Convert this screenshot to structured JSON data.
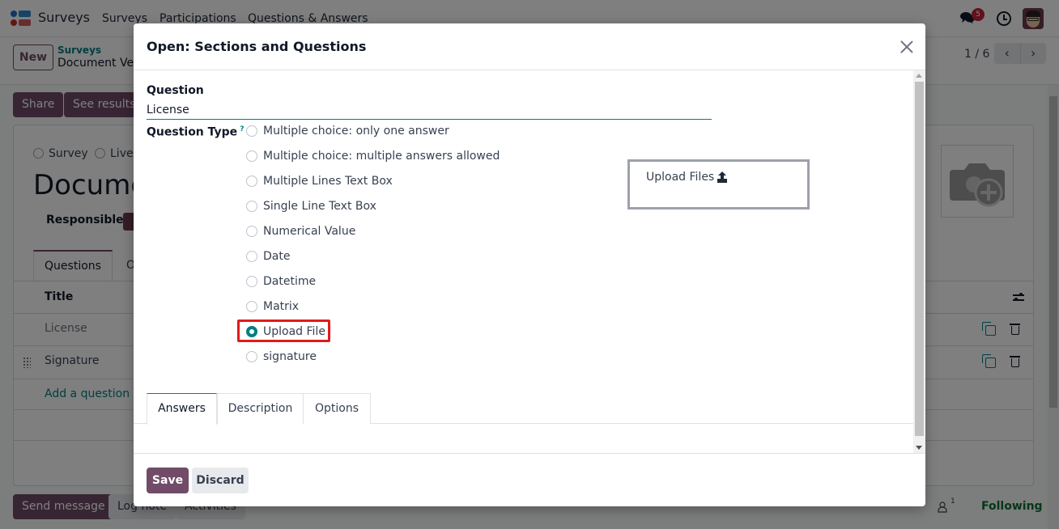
{
  "navbar": {
    "app_name": "Surveys",
    "menu": [
      "Surveys",
      "Participations",
      "Questions & Answers"
    ],
    "messages_badge": "5",
    "icons": [
      "chat-icon",
      "clock-icon",
      "user-avatar"
    ]
  },
  "control_panel": {
    "new_label": "New",
    "breadcrumb_parent": "Surveys",
    "breadcrumb_current": "Document Verification",
    "pager": "1 / 6",
    "prev_icon": "‹",
    "next_icon": "›"
  },
  "actions": {
    "share": "Share",
    "see_results": "See results"
  },
  "form": {
    "survey_type_options": [
      "Survey",
      "Live"
    ],
    "title": "Document Verification",
    "responsible_label": "Responsible",
    "tabs": [
      "Questions",
      "Options"
    ],
    "list": {
      "header_title": "Title",
      "rows": [
        {
          "title": "License"
        },
        {
          "title": "Signature"
        }
      ],
      "add_label": "Add a question"
    }
  },
  "chatter": {
    "send_message": "Send message",
    "log_note": "Log note",
    "activities": "Activities",
    "followers_count": "1",
    "following": "Following"
  },
  "modal": {
    "title": "Open: Sections and Questions",
    "question_label": "Question",
    "question_value": "License",
    "question_type_label": "Question Type",
    "help_mark": "?",
    "question_types": [
      {
        "label": "Multiple choice: only one answer",
        "checked": false
      },
      {
        "label": "Multiple choice: multiple answers allowed",
        "checked": false
      },
      {
        "label": "Multiple Lines Text Box",
        "checked": false
      },
      {
        "label": "Single Line Text Box",
        "checked": false
      },
      {
        "label": "Numerical Value",
        "checked": false
      },
      {
        "label": "Date",
        "checked": false
      },
      {
        "label": "Datetime",
        "checked": false
      },
      {
        "label": "Matrix",
        "checked": false
      },
      {
        "label": "Upload File",
        "checked": true
      },
      {
        "label": "signature",
        "checked": false
      }
    ],
    "preview_label": "Upload Files",
    "tabs": [
      {
        "label": "Answers",
        "active": true
      },
      {
        "label": "Description",
        "active": false
      },
      {
        "label": "Options",
        "active": false
      }
    ],
    "save_label": "Save",
    "discard_label": "Discard"
  },
  "colors": {
    "brand": "#714b67",
    "accent": "#017e84",
    "highlight": "#e01b1b"
  }
}
